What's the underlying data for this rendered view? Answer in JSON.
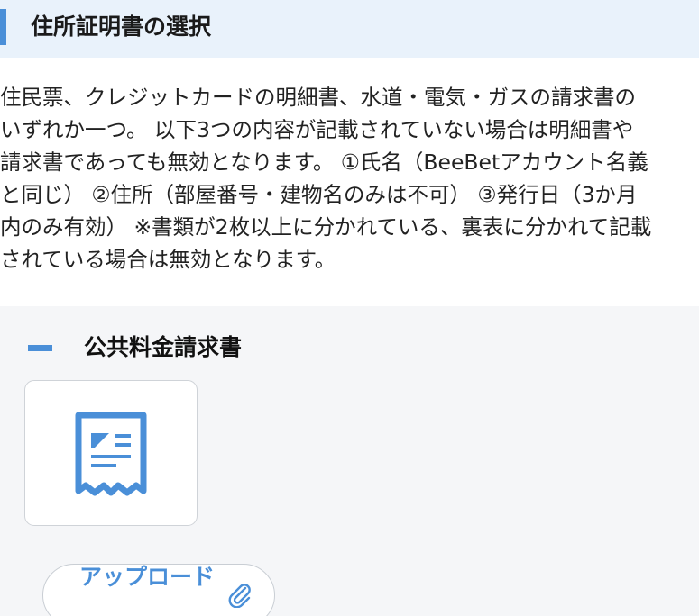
{
  "header": {
    "title": "住所証明書の選択"
  },
  "description": {
    "lines": [
      "住民票、クレジットカードの明細書、水道・電気・ガスの請求書の",
      "いずれか一つ。 以下3つの内容が記載されていない場合は明細書や",
      "請求書であっても無効となります。 ①氏名（BeeBetアカウント名義",
      "と同じ） ②住所（部屋番号・建物名のみは不可） ③発行日（3か月",
      "内のみ有効） ※書類が2枚以上に分かれている、裏表に分かれて記載",
      "されている場合は無効となります。"
    ]
  },
  "section": {
    "title": "公共料金請求書",
    "card_icon": "document-receipt-icon",
    "upload_label": "アップロード",
    "upload_icon": "paperclip-icon"
  },
  "colors": {
    "accent": "#4a8fd8",
    "header_bg": "#e9f2fb",
    "panel_bg": "#f5f6f8",
    "text": "#222222"
  }
}
